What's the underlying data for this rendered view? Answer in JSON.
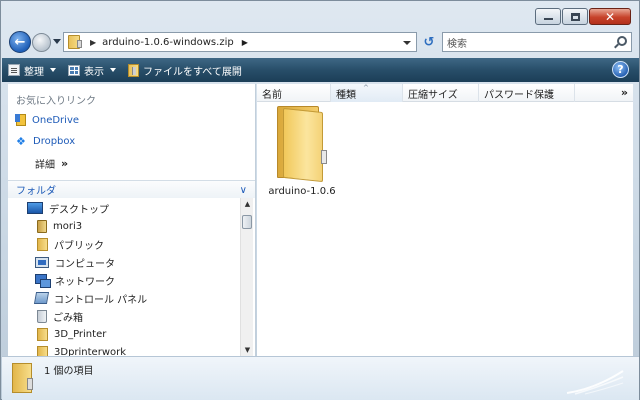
{
  "window": {
    "caption_buttons": [
      "minimize",
      "maximize",
      "close"
    ]
  },
  "nav": {
    "address_path": "arduino-1.0.6-windows.zip",
    "search_placeholder": "検索"
  },
  "toolbar": {
    "organize_label": "整理",
    "views_label": "表示",
    "extract_all_label": "ファイルをすべて展開",
    "help_label": "?"
  },
  "sidebar": {
    "favorites_header": "お気に入りリンク",
    "favorites": [
      {
        "label": "OneDrive",
        "icon": "onedrive-icon"
      },
      {
        "label": "Dropbox",
        "icon": "dropbox-icon"
      }
    ],
    "more_label": "詳細",
    "more_chevron": "»",
    "folders_label": "フォルダ",
    "folders_chevron": "∨",
    "tree": [
      {
        "label": "デスクトップ",
        "icon": "desktop-icon"
      },
      {
        "label": "mori3",
        "icon": "user-folder-icon"
      },
      {
        "label": "パブリック",
        "icon": "folder-icon"
      },
      {
        "label": "コンピュータ",
        "icon": "computer-icon"
      },
      {
        "label": "ネットワーク",
        "icon": "network-icon"
      },
      {
        "label": "コントロール パネル",
        "icon": "control-panel-icon"
      },
      {
        "label": "ごみ箱",
        "icon": "recycle-bin-icon"
      },
      {
        "label": "3D_Printer",
        "icon": "folder-icon"
      },
      {
        "label": "3Dprinterwork",
        "icon": "folder-icon"
      }
    ]
  },
  "content": {
    "columns": [
      "名前",
      "種類",
      "圧縮サイズ",
      "パスワード保護"
    ],
    "more_columns": "»",
    "items": [
      {
        "name": "arduino-1.0.6",
        "icon": "zip-folder-icon"
      }
    ]
  },
  "details": {
    "text": "1 個の項目"
  },
  "colors": {
    "toolbar": "#284e69",
    "link": "#1e5bb8",
    "close_button": "#c7432a"
  }
}
